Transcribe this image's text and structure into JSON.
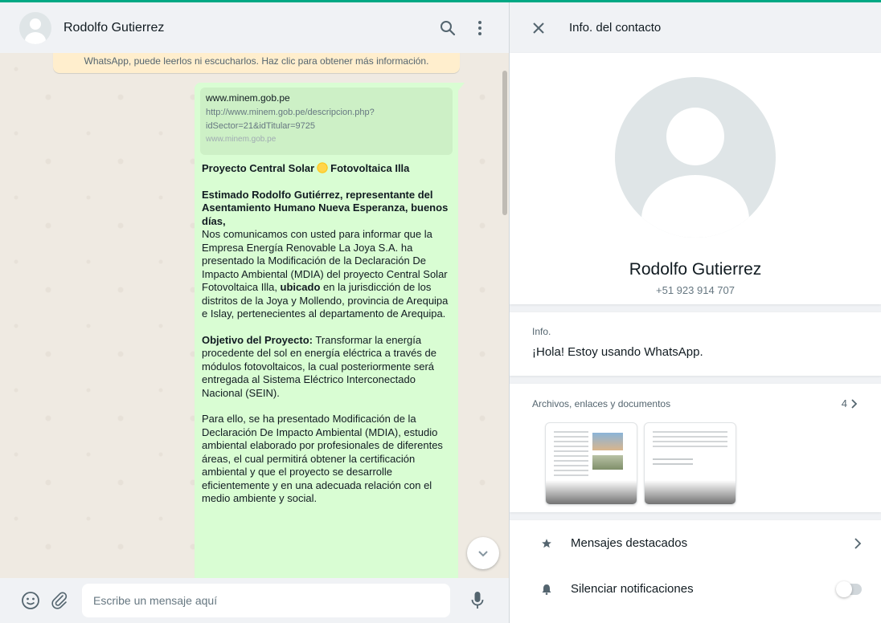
{
  "chat": {
    "contact_name": "Rodolfo Gutierrez",
    "encryption_notice": "WhatsApp, puede leerlos ni escucharlos. Haz clic para obtener más información.",
    "link_preview": {
      "title": "www.minem.gob.pe",
      "description": "http://www.minem.gob.pe/descripcion.php?idSector=21&idTitular=9725",
      "domain": "www.minem.gob.pe"
    },
    "message": {
      "heading_pre": "Proyecto Central Solar",
      "heading_post": "Fotovoltaica Illa",
      "greeting": "Estimado Rodolfo Gutiérrez, representante del Asentamiento Humano Nueva Esperanza, buenos días,",
      "p1_start": "Nos comunicamos con usted para informar que la Empresa Energía Renovable La Joya S.A. ha presentado la Modificación de la Declaración De Impacto Ambiental (MDIA) del proyecto Central Solar Fotovoltaica Illa, ",
      "p1_bold": "ubicado",
      "p1_end": " en la jurisdicción de los distritos de la Joya y Mollendo, provincia de Arequipa e Islay, pertenecientes al departamento de Arequipa.",
      "p2_bold": "Objetivo del Proyecto:",
      "p2_text": " Transformar la energía procedente del sol en energía eléctrica a través de módulos fotovoltaicos, la cual posteriormente será entregada al Sistema Eléctrico Interconectado Nacional (SEIN).",
      "p3": "Para ello, se ha presentado Modificación de la Declaración De Impacto Ambiental (MDIA), estudio ambiental elaborado por profesionales de diferentes áreas, el cual permitirá obtener la certificación ambiental y que el proyecto se desarrolle eficientemente y en una adecuada relación con el medio ambiente y social."
    },
    "composer": {
      "placeholder": "Escribe un mensaje aquí"
    }
  },
  "info": {
    "title": "Info. del contacto",
    "name": "Rodolfo Gutierrez",
    "phone": "+51 923 914 707",
    "about_label": "Info.",
    "about_text": "¡Hola! Estoy usando WhatsApp.",
    "media_label": "Archivos, enlaces y documentos",
    "media_count": "4",
    "settings": [
      {
        "label": "Mensajes destacados",
        "icon": "star-icon"
      },
      {
        "label": "Silenciar notificaciones",
        "icon": "bell-icon"
      }
    ]
  },
  "colors": {
    "accent": "#00a884",
    "bubble_out": "#d9fdd3",
    "notice_bg": "#ffeecd",
    "panel_bg": "#f0f2f5"
  }
}
